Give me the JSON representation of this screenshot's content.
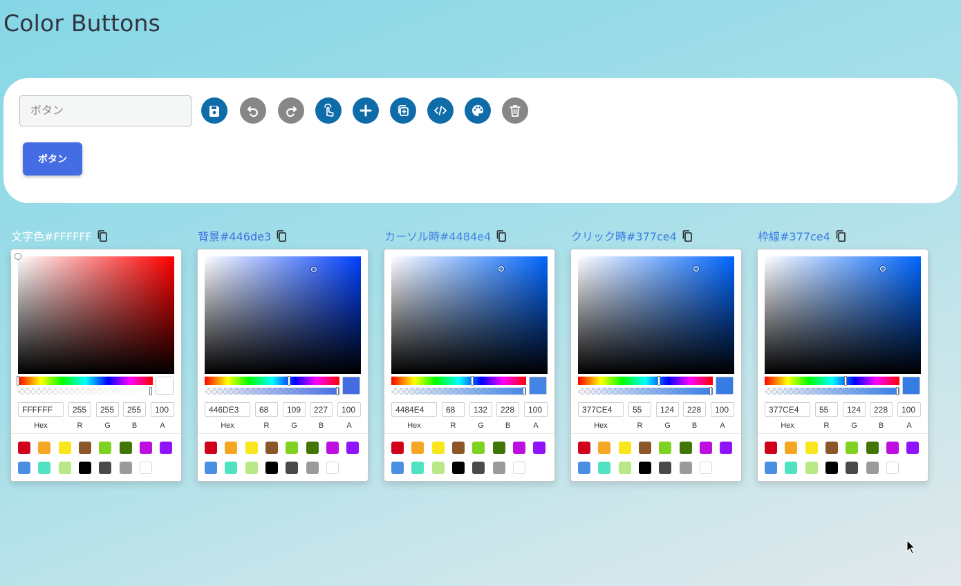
{
  "title": "Color Buttons",
  "editor": {
    "input_value": "",
    "input_placeholder": "ボタン",
    "toolbar": [
      {
        "name": "save-button",
        "icon": "save-icon",
        "tone": "blue"
      },
      {
        "name": "undo-button",
        "icon": "undo-icon",
        "tone": "grey"
      },
      {
        "name": "redo-button",
        "icon": "redo-icon",
        "tone": "grey"
      },
      {
        "name": "pointer-button",
        "icon": "touch-icon",
        "tone": "blue"
      },
      {
        "name": "add-button",
        "icon": "plus-icon",
        "tone": "blue"
      },
      {
        "name": "duplicate-button",
        "icon": "duplicate-icon",
        "tone": "blue"
      },
      {
        "name": "code-button",
        "icon": "code-icon",
        "tone": "blue"
      },
      {
        "name": "palette-button",
        "icon": "palette-icon",
        "tone": "blue"
      },
      {
        "name": "delete-button",
        "icon": "trash-icon",
        "tone": "grey"
      }
    ],
    "preview_button_label": "ボタン"
  },
  "colors": [
    {
      "label": "文字色#FFFFFF",
      "label_color": "#ffffff",
      "hex": "FFFFFF",
      "r": "255",
      "g": "255",
      "b": "255",
      "a": "100",
      "hue": 0,
      "color": "#ffffff"
    },
    {
      "label": "背景#446de3",
      "label_color": "#446de3",
      "hex": "446DE3",
      "r": "68",
      "g": "109",
      "b": "227",
      "a": "100",
      "hue": 225,
      "color": "#446de3"
    },
    {
      "label": "カーソル時#4484e4",
      "label_color": "#4484e4",
      "hex": "4484E4",
      "r": "68",
      "g": "132",
      "b": "228",
      "a": "100",
      "hue": 216,
      "color": "#4484e4"
    },
    {
      "label": "クリック時#377ce4",
      "label_color": "#377ce4",
      "hex": "377CE4",
      "r": "55",
      "g": "124",
      "b": "228",
      "a": "100",
      "hue": 216,
      "color": "#377ce4"
    },
    {
      "label": "枠線#377ce4",
      "label_color": "#377ce4",
      "hex": "377CE4",
      "r": "55",
      "g": "124",
      "b": "228",
      "a": "100",
      "hue": 216,
      "color": "#377ce4"
    }
  ],
  "field_labels": {
    "hex": "Hex",
    "r": "R",
    "g": "G",
    "b": "B",
    "a": "A"
  },
  "presets": [
    "#d0021b",
    "#f5a623",
    "#f8e71c",
    "#8b572a",
    "#7ed321",
    "#417505",
    "#bd10e0",
    "#9013fe",
    "#4a90e2",
    "#50e3c2",
    "#b8e986",
    "#000000",
    "#4a4a4a",
    "#9b9b9b",
    "#ffffff"
  ]
}
